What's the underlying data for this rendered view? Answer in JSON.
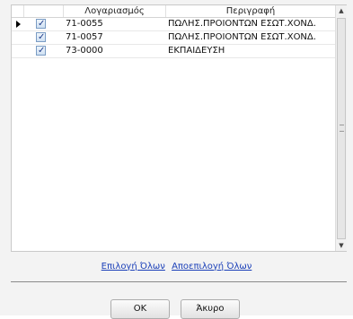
{
  "grid": {
    "columns": {
      "account": "Λογαριασμός",
      "description": "Περιγραφή"
    },
    "rows": [
      {
        "checked": true,
        "account": "71-0055",
        "description": "ΠΩΛΗΣ.ΠΡΟΙΟΝΤΩΝ ΕΣΩΤ.ΧΟΝΔ.",
        "current": true
      },
      {
        "checked": true,
        "account": "71-0057",
        "description": "ΠΩΛΗΣ.ΠΡΟΙΟΝΤΩΝ ΕΣΩΤ.ΧΟΝΔ.",
        "current": false
      },
      {
        "checked": true,
        "account": "73-0000",
        "description": "ΕΚΠΑΙΔΕΥΣΗ",
        "current": false
      }
    ]
  },
  "links": {
    "select_all": "Επιλογή Όλων",
    "deselect_all": "Αποεπιλογή Όλων"
  },
  "buttons": {
    "ok": "OK",
    "cancel": "Άκυρο"
  },
  "colors": {
    "link": "#1a3fb8",
    "checkbox_mark": "#1d3b8a"
  }
}
